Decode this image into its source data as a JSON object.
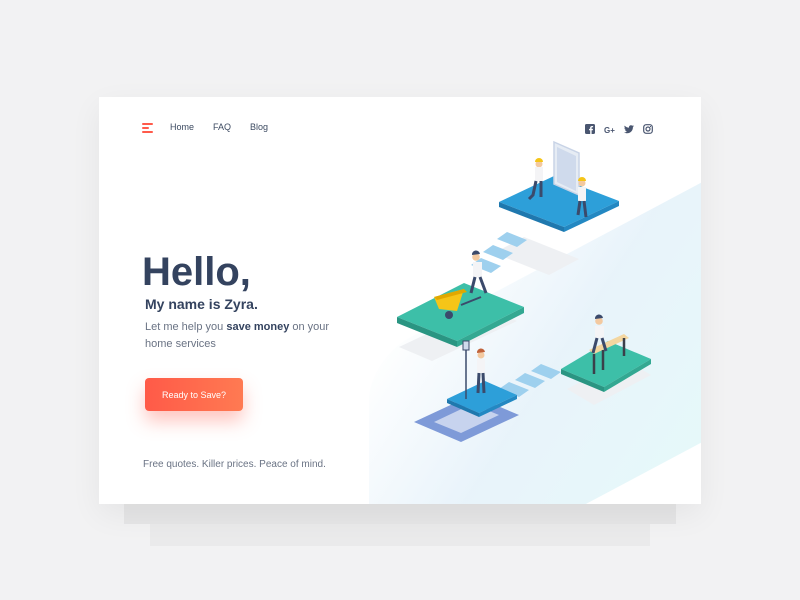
{
  "nav": {
    "items": [
      {
        "label": "Home"
      },
      {
        "label": "FAQ"
      },
      {
        "label": "Blog"
      }
    ],
    "menu_icon": "hamburger-menu-icon"
  },
  "social": [
    {
      "icon": "facebook-icon",
      "glyph": "f"
    },
    {
      "icon": "google-plus-icon",
      "glyph": "G+"
    },
    {
      "icon": "twitter-icon",
      "glyph": ""
    },
    {
      "icon": "instagram-icon",
      "glyph": ""
    }
  ],
  "hero": {
    "title": "Hello,",
    "subtitle": "My name is Zyra.",
    "desc_prefix": "Let me help you ",
    "desc_bold": "save money",
    "desc_suffix": " on your home services",
    "cta_label": "Ready to Save?",
    "tagline": "Free quotes. Killer prices. Peace of mind."
  },
  "colors": {
    "accent": "#ff5b4b",
    "heading": "#34435f",
    "blue_platform": "#2d9fd9",
    "green_platform": "#3dbfa8"
  }
}
